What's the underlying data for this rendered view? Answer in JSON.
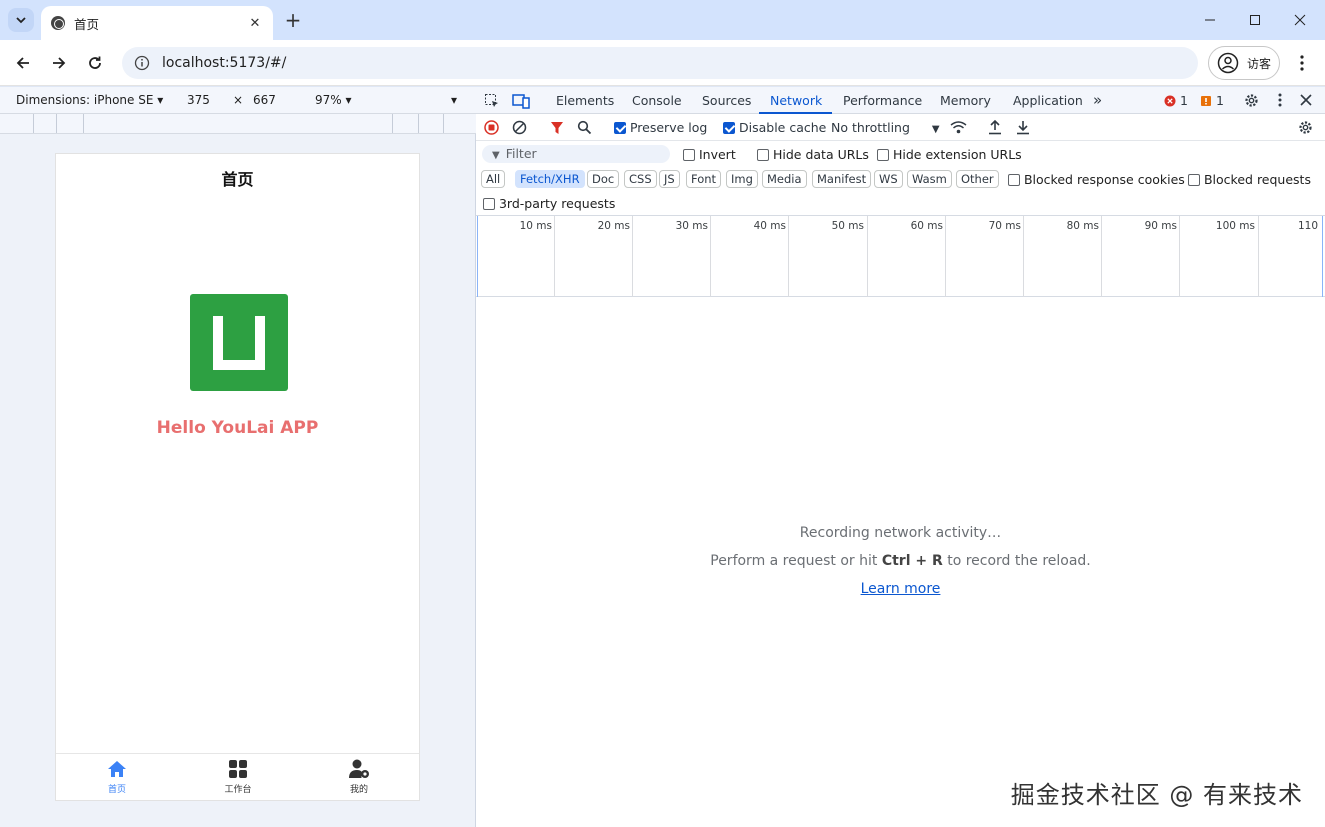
{
  "browser": {
    "tab_title": "首页",
    "url": "localhost:5173/#/",
    "profile_label": "访客"
  },
  "device_toolbar": {
    "dimensions_label": "Dimensions: iPhone SE ▾",
    "width": "375",
    "times": "×",
    "height": "667",
    "zoom": "97% ▾",
    "more": "▾"
  },
  "phone": {
    "title": "首页",
    "hello": "Hello YouLai APP",
    "tabbar": [
      {
        "label": "首页",
        "icon": "home-icon",
        "active": true
      },
      {
        "label": "工作台",
        "icon": "grid-icon",
        "active": false
      },
      {
        "label": "我的",
        "icon": "user-gear-icon",
        "active": false
      }
    ],
    "accent_color": "#3b82f6",
    "hello_color": "#e86f6f",
    "logo_color": "#2da042"
  },
  "devtools": {
    "tabs": [
      "Elements",
      "Console",
      "Sources",
      "Network",
      "Performance",
      "Memory",
      "Application"
    ],
    "active_tab": "Network",
    "more_tabs": "»",
    "error_count": "1",
    "warning_count": "1",
    "preserve_log": "Preserve log",
    "disable_cache": "Disable cache",
    "throttling": "No throttling",
    "filter_placeholder": "Filter",
    "invert": "Invert",
    "hide_data_urls": "Hide data URLs",
    "hide_extension_urls": "Hide extension URLs",
    "types": [
      "All",
      "Fetch/XHR",
      "Doc",
      "CSS",
      "JS",
      "Font",
      "Img",
      "Media",
      "Manifest",
      "WS",
      "Wasm",
      "Other"
    ],
    "active_type": "Fetch/XHR",
    "blocked_response_cookies": "Blocked response cookies",
    "blocked_requests": "Blocked requests",
    "third_party": "3rd-party requests",
    "timeline_ticks": [
      "10 ms",
      "20 ms",
      "30 ms",
      "40 ms",
      "50 ms",
      "60 ms",
      "70 ms",
      "80 ms",
      "90 ms",
      "100 ms",
      "110"
    ],
    "recording": "Recording network activity…",
    "perform_prefix": "Perform a request or hit ",
    "perform_keys": "Ctrl + R",
    "perform_suffix": " to record the reload.",
    "learn_more": "Learn more"
  },
  "watermark": "掘金技术社区 @ 有来技术"
}
